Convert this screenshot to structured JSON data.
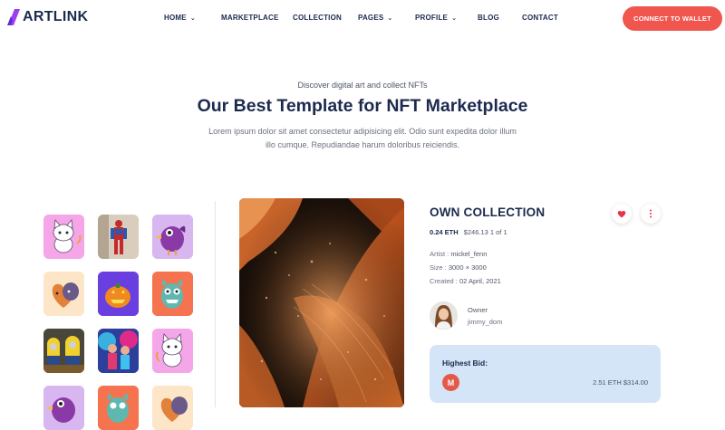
{
  "header": {
    "logo_text": "ARTLINK",
    "nav": [
      {
        "label": "HOME",
        "has_dropdown": true
      },
      {
        "label": "MARKETPLACE",
        "has_dropdown": false
      },
      {
        "label": "COLLECTION",
        "has_dropdown": false
      },
      {
        "label": "PAGES",
        "has_dropdown": true
      },
      {
        "label": "PROFILE",
        "has_dropdown": true
      },
      {
        "label": "BLOG",
        "has_dropdown": false
      },
      {
        "label": "CONTACT",
        "has_dropdown": false
      }
    ],
    "connect_label": "CONNECT TO WALLET",
    "accent": "#f0554e"
  },
  "hero": {
    "subtitle": "Discover digital art and collect NFTs",
    "title": "Our Best Template for NFT Marketplace",
    "description": "Lorem ipsum dolor sit amet consectetur adipisicing elit. Odio sunt expedita dolor illum illo cumque. Repudiandae harum doloribus reiciendis."
  },
  "thumbnails": [
    {
      "name": "white-cat-thumbnail",
      "bg": "#f4a6e8"
    },
    {
      "name": "robot-figure-thumbnail",
      "bg": "#e8ddd2"
    },
    {
      "name": "purple-bird-thumbnail",
      "bg": "#d8b6ef"
    },
    {
      "name": "heart-creatures-thumbnail",
      "bg": "#fde6c8"
    },
    {
      "name": "pumpkin-thumbnail",
      "bg": "#7b4fe8"
    },
    {
      "name": "monster-thumbnail",
      "bg": "#f5734f"
    },
    {
      "name": "minions-thumbnail",
      "bg": "#3b3a2e"
    },
    {
      "name": "concert-thumbnail",
      "bg": "#2c5fb8"
    },
    {
      "name": "white-cat-thumbnail-2",
      "bg": "#f4a6e8"
    },
    {
      "name": "purple-bird-thumbnail-2",
      "bg": "#d8b6ef"
    },
    {
      "name": "monster-thumbnail-2",
      "bg": "#f5734f"
    },
    {
      "name": "heart-creatures-thumbnail-2",
      "bg": "#fde6c8"
    }
  ],
  "item": {
    "collection_title": "OWN COLLECTION",
    "price_eth": "0.24 ETH",
    "price_usd": "$246.13 1 of 1",
    "artist_label": "Artist : ",
    "artist_value": "mickel_fenn",
    "size_label": "Size : ",
    "size_value": "3000 × 3000",
    "created_label": "Created : ",
    "created_value": "02 April, 2021",
    "owner_label": "Owner",
    "owner_name": "jimmy_dom",
    "like_icon": "heart-icon",
    "more_icon": "more-vertical-icon"
  },
  "bid": {
    "title": "Highest Bid:",
    "bidder_initial": "M",
    "value": "2.51 ETH $314.00",
    "box_color": "#d4e5f8"
  }
}
